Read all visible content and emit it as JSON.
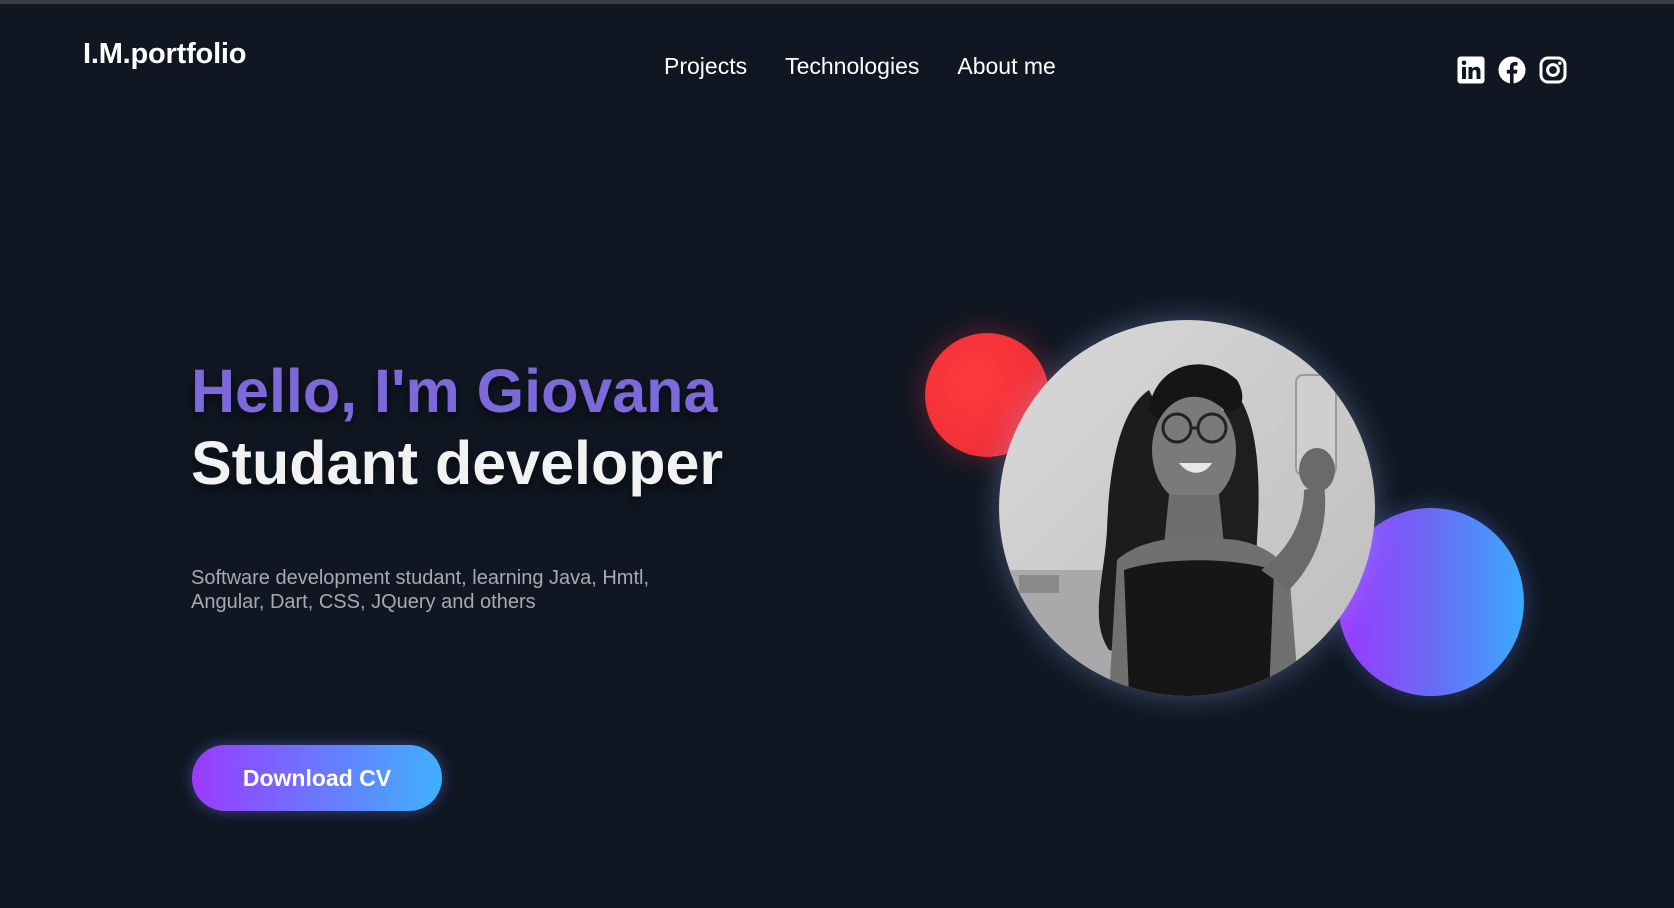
{
  "header": {
    "logo": "I.M.portfolio",
    "nav": [
      {
        "label": "Projects"
      },
      {
        "label": "Technologies"
      },
      {
        "label": "About me"
      }
    ],
    "social": [
      "linkedin-icon",
      "facebook-icon",
      "instagram-icon"
    ]
  },
  "hero": {
    "greeting": "Hello, I'm Giovana",
    "role": "Studant developer",
    "description": "Software development studant, learning Java, Hmtl, Angular, Dart, CSS, JQuery and others",
    "cta_label": "Download CV"
  },
  "colors": {
    "background": "#101722",
    "accent_purple": "#7d69d9",
    "gradient_start": "#9a3bff",
    "gradient_end": "#3fb1ff",
    "circle_red": "#f02f3a"
  }
}
